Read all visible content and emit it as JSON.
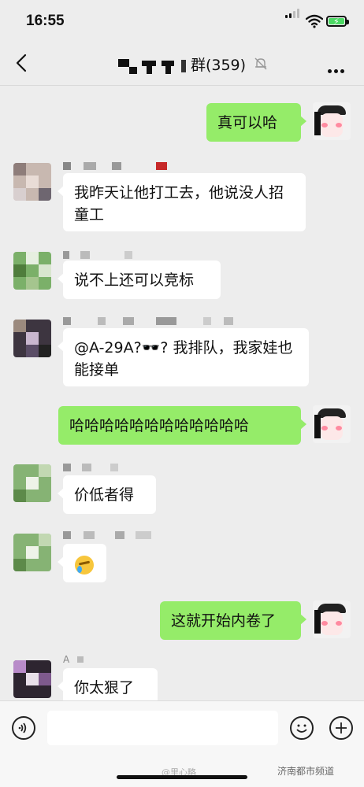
{
  "status_bar": {
    "time": "16:55"
  },
  "nav": {
    "title": "群(359)"
  },
  "messages": [
    {
      "id": "m1",
      "side": "out",
      "text": "真可以哈"
    },
    {
      "id": "m2",
      "side": "in",
      "text": "我昨天让他打工去，他说没人招童工"
    },
    {
      "id": "m3",
      "side": "in",
      "text": "说不上还可以竞标"
    },
    {
      "id": "m4",
      "side": "in",
      "text": "@A-29A?🕶️? 我排队，我家娃也能接单"
    },
    {
      "id": "m5",
      "side": "out",
      "text": "哈哈哈哈哈哈哈哈哈哈哈哈"
    },
    {
      "id": "m6",
      "side": "in",
      "text": "价低者得"
    },
    {
      "id": "m7",
      "side": "in",
      "text": "",
      "emoji": "face-with-tears-of-joy"
    },
    {
      "id": "m8",
      "side": "out",
      "text": "这就开始内卷了"
    },
    {
      "id": "m9",
      "side": "in",
      "sender": "A",
      "text": "你太狠了"
    }
  ],
  "watermark": {
    "left": "@里心略",
    "right": "济南都市频道"
  },
  "icons": {
    "voice": "voice-icon",
    "emoji": "emoji-icon",
    "plus": "plus-icon"
  }
}
